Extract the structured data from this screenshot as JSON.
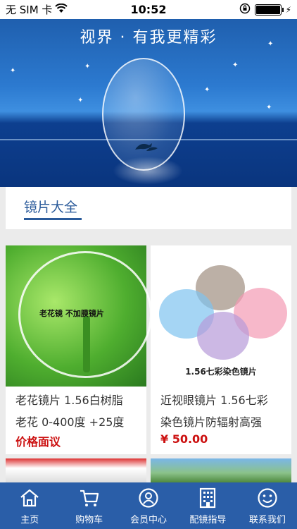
{
  "status_bar": {
    "carrier": "无 SIM 卡",
    "time": "10:52"
  },
  "banner": {
    "title": "视界 · 有我更精彩"
  },
  "section": {
    "title": "镜片大全"
  },
  "products": [
    {
      "image_caption": "老花镜 不加膜镜片",
      "name_line1": "老花镜片 1.56白树脂",
      "name_line2": "老花 0-400度 +25度",
      "price": "价格面议"
    },
    {
      "image_caption": "1.56七彩染色镜片",
      "name_line1": "近视眼镜片 1.56七彩",
      "name_line2": "染色镜片防辐射高强",
      "price": "¥ 50.00"
    }
  ],
  "tabbar": {
    "items": [
      {
        "label": "主页",
        "icon": "home-icon"
      },
      {
        "label": "购物车",
        "icon": "cart-icon"
      },
      {
        "label": "会员中心",
        "icon": "user-icon"
      },
      {
        "label": "配镜指导",
        "icon": "building-icon"
      },
      {
        "label": "联系我们",
        "icon": "smiley-icon"
      }
    ]
  },
  "colors": {
    "accent": "#2a5ea8",
    "price": "#cc1111"
  }
}
